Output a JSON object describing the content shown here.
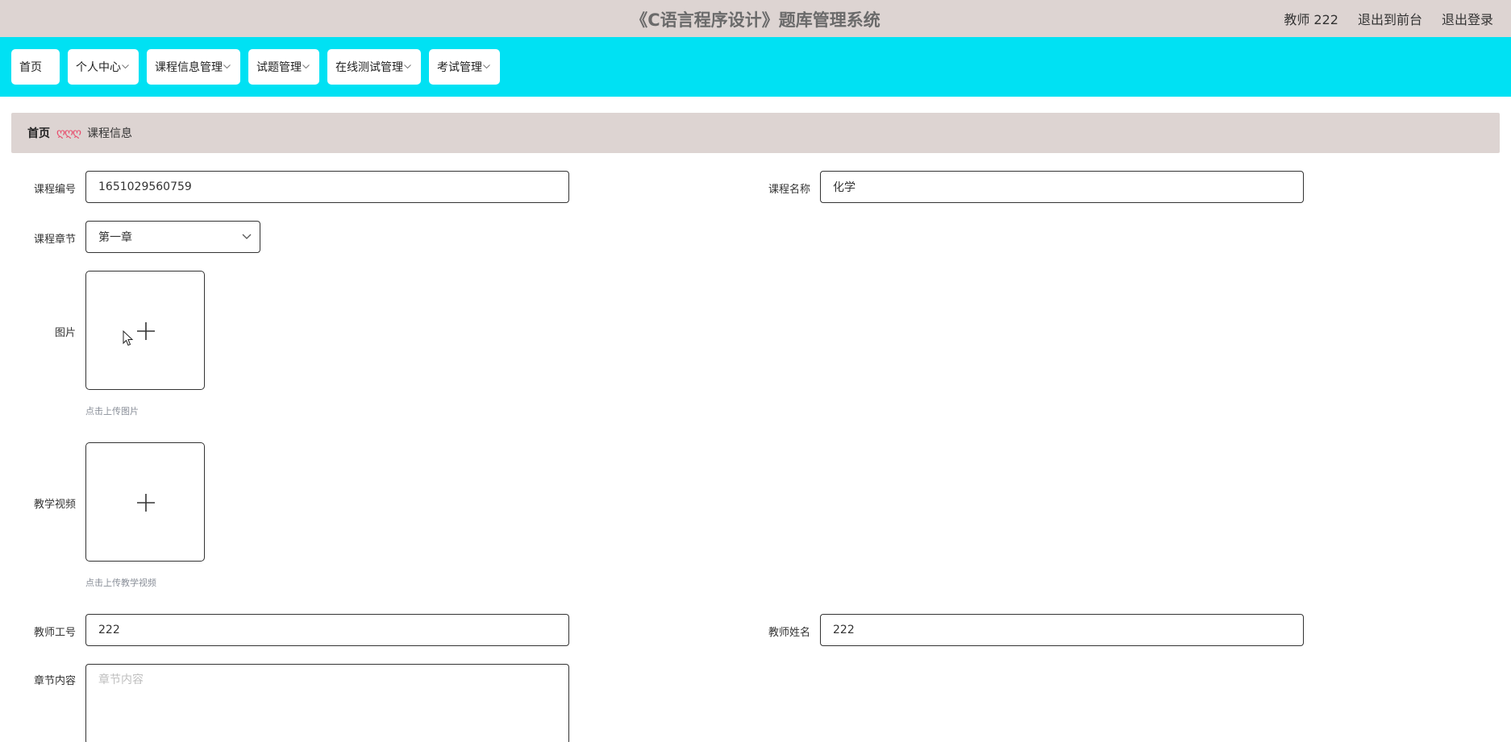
{
  "header": {
    "title": "《C语言程序设计》题库管理系统",
    "user_label": "教师 222",
    "front_link": "退出到前台",
    "logout_link": "退出登录"
  },
  "nav": {
    "items": [
      {
        "label": "首页",
        "has_dropdown": false
      },
      {
        "label": "个人中心",
        "has_dropdown": true
      },
      {
        "label": "课程信息管理",
        "has_dropdown": true
      },
      {
        "label": "试题管理",
        "has_dropdown": true
      },
      {
        "label": "在线测试管理",
        "has_dropdown": true
      },
      {
        "label": "考试管理",
        "has_dropdown": true
      }
    ],
    "dropdown_icon": "chevron-down-icon"
  },
  "breadcrumb": {
    "home": "首页",
    "separator": "ღღღ",
    "current": "课程信息"
  },
  "form": {
    "course_no_label": "课程编号",
    "course_no_value": "1651029560759",
    "course_name_label": "课程名称",
    "course_name_value": "化学",
    "chapter_label": "课程章节",
    "chapter_value": "第一章",
    "image_label": "图片",
    "image_hint": "点击上传图片",
    "video_label": "教学视频",
    "video_hint": "点击上传教学视频",
    "teacher_no_label": "教师工号",
    "teacher_no_value": "222",
    "teacher_name_label": "教师姓名",
    "teacher_name_value": "222",
    "content_label": "章节内容",
    "content_placeholder": "章节内容"
  },
  "colors": {
    "header_bg": "#ddd4d2",
    "nav_bg": "#00e1f3",
    "breadcrumb_sep": "#e84a6a",
    "hint_text": "#8a8f99"
  }
}
